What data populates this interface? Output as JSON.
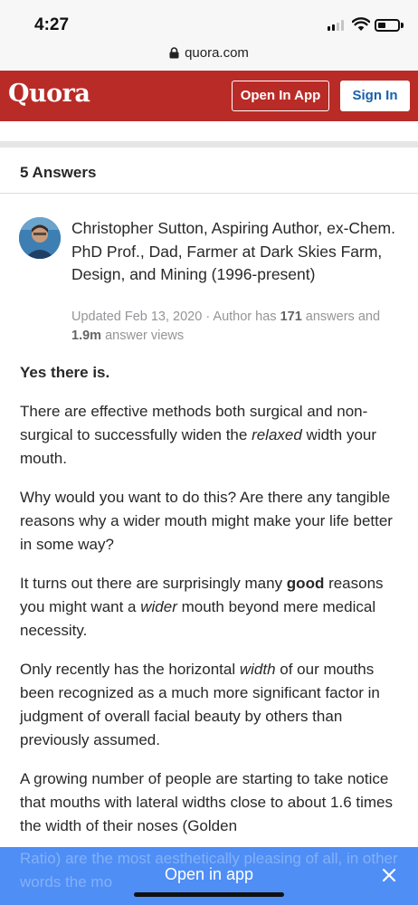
{
  "status_bar": {
    "time": "4:27"
  },
  "browser": {
    "url": "quora.com"
  },
  "header": {
    "logo": "Quora",
    "open_in_app": "Open In App",
    "sign_in": "Sign In"
  },
  "answers_header": {
    "count_label": "5 Answers"
  },
  "answer": {
    "author_credential": "Christopher Sutton, Aspiring Author, ex-Chem. PhD Prof., Dad, Farmer at Dark Skies Farm, Design, and Mining (1996-present)",
    "meta": {
      "updated": "Updated Feb 13, 2020 · Author has ",
      "answers_num": "171",
      "answers_mid": " answers and ",
      "views_num": "1.9m",
      "views_tail": " answer views"
    },
    "paragraphs": {
      "p1": "Yes there is.",
      "p2_a": "There are effective methods both surgical and non-surgical to successfully widen the ",
      "p2_i": "relaxed",
      "p2_b": " width your mouth.",
      "p3": "Why would you want to do this? Are there any tangible reasons why a wider mouth might make your life better in some way?",
      "p4_a": "It turns out there are surprisingly many ",
      "p4_bold": "good",
      "p4_b": " reasons you might want a ",
      "p4_i": "wider",
      "p4_c": " mouth beyond mere medical necessity.",
      "p5_a": "Only recently has the horizontal ",
      "p5_i": "width",
      "p5_b": " of our mouths been recognized as a much more significant factor in judgment of overall facial beauty by others than previously assumed.",
      "p6": "A growing number of people are starting to take notice that mouths with lateral widths close to about 1.6 times the width of their noses (Golden",
      "p7": "Ratio) are the most aesthetically pleasing of all, in other words the mo"
    }
  },
  "banner": {
    "label": "Open in app"
  }
}
